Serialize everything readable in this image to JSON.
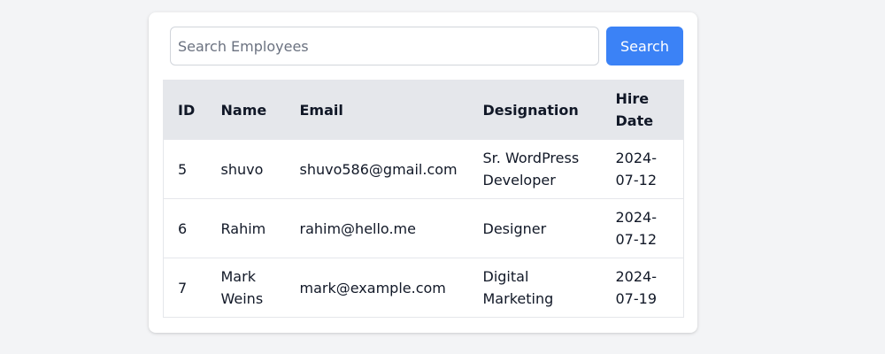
{
  "search": {
    "placeholder": "Search Employees",
    "value": "",
    "button_label": "Search"
  },
  "table": {
    "headers": [
      "ID",
      "Name",
      "Email",
      "Designation",
      "Hire Date"
    ],
    "rows": [
      {
        "id": "5",
        "name": "shuvo",
        "email": "shuvo586@gmail.com",
        "designation": "Sr. WordPress Developer",
        "hire_date": "2024-07-12"
      },
      {
        "id": "6",
        "name": "Rahim",
        "email": "rahim@hello.me",
        "designation": "Designer",
        "hire_date": "2024-07-12"
      },
      {
        "id": "7",
        "name": "Mark Weins",
        "email": "mark@example.com",
        "designation": "Digital Marketing",
        "hire_date": "2024-07-19"
      }
    ]
  },
  "colors": {
    "accent": "#3b82f6",
    "header_bg": "#e5e7eb",
    "page_bg": "#f3f4f6"
  }
}
